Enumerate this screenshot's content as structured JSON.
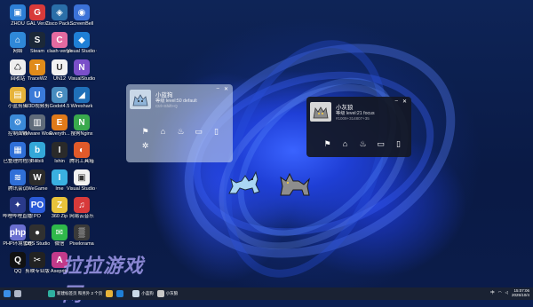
{
  "desktop_icons": [
    {
      "label": "ZHOU",
      "color": "#2d7fd6",
      "glyph": "▣",
      "name": "this-pc-icon"
    },
    {
      "label": "GAL Ver.2",
      "color": "#d83a3a",
      "glyph": "G",
      "name": "gal-icon"
    },
    {
      "label": "Cisco Pack...",
      "color": "#2a6ea8",
      "glyph": "◈",
      "name": "cisco-icon"
    },
    {
      "label": "ScreenBell",
      "color": "#3b72d8",
      "glyph": "◉",
      "name": "screenbell-icon"
    },
    {
      "label": "网络",
      "color": "#2f88d8",
      "glyph": "⌂",
      "name": "network-icon"
    },
    {
      "label": "Steam",
      "color": "#1b2838",
      "glyph": "S",
      "name": "steam-icon"
    },
    {
      "label": "clash-verge",
      "color": "#e36aa0",
      "glyph": "C",
      "name": "clash-icon"
    },
    {
      "label": "Visual Studio Code",
      "color": "#1f7fd6",
      "glyph": "◆",
      "name": "vscode-icon"
    },
    {
      "label": "回收站",
      "color": "#eeeeee",
      "glyph": "♺",
      "name": "recycle-bin-icon"
    },
    {
      "label": "TraceW2",
      "color": "#e08b1a",
      "glyph": "T",
      "name": "trace-icon"
    },
    {
      "label": "UN12",
      "color": "#f2f2f2",
      "glyph": "U",
      "name": "un12-icon"
    },
    {
      "label": "VisualStudio",
      "color": "#7a4fc9",
      "glyph": "N",
      "name": "visualstudio-icon"
    },
    {
      "label": "小蓝剪辑",
      "color": "#e6b33a",
      "glyph": "▤",
      "name": "folder-icon"
    },
    {
      "label": "U3D视频剪",
      "color": "#3a7ad8",
      "glyph": "U",
      "name": "u3d-icon"
    },
    {
      "label": "Godot4.5",
      "color": "#478cbf",
      "glyph": "G",
      "name": "godot-icon"
    },
    {
      "label": "Wireshark",
      "color": "#1f6fb8",
      "glyph": "◢",
      "name": "wireshark-icon"
    },
    {
      "label": "控制面板",
      "color": "#3b8ad8",
      "glyph": "⚙",
      "name": "control-panel-icon"
    },
    {
      "label": "VMware Workstat...",
      "color": "#5f6b7a",
      "glyph": "▥",
      "name": "vmware-icon"
    },
    {
      "label": "Everyth...",
      "color": "#e07a1a",
      "glyph": "E",
      "name": "everything-icon"
    },
    {
      "label": "搜狗Nginx",
      "color": "#39a94d",
      "glyph": "N",
      "name": "nginx-icon"
    },
    {
      "label": "已整理的程序",
      "color": "#2f6fd8",
      "glyph": "▦",
      "name": "programs-icon"
    },
    {
      "label": "Bilibili",
      "color": "#33a7d8",
      "glyph": "b",
      "name": "bilibili-icon"
    },
    {
      "label": "Ishin",
      "color": "#2a2a2a",
      "glyph": "I",
      "name": "ishin-icon"
    },
    {
      "label": "腾讯工具箱",
      "color": "#e05a2a",
      "glyph": "◐",
      "name": "toolbox-icon"
    },
    {
      "label": "腾讯会议",
      "color": "#2f6fd8",
      "glyph": "≋",
      "name": "meeting-icon"
    },
    {
      "label": "WeGame",
      "color": "#2c2c2c",
      "glyph": "W",
      "name": "wegame-icon"
    },
    {
      "label": "Ime",
      "color": "#3ab0e0",
      "glyph": "I",
      "name": "ime-icon"
    },
    {
      "label": "Visual Studio Code wor...",
      "color": "#f2f2f2",
      "glyph": "▣",
      "name": "vscode-workspace-icon"
    },
    {
      "label": "哔哩哔哩直播姬",
      "color": "#2a3a8a",
      "glyph": "✦",
      "name": "live-icon"
    },
    {
      "label": "PO",
      "color": "#2a5ad8",
      "glyph": "PO",
      "name": "po-icon"
    },
    {
      "label": "360 Zip",
      "color": "#e8c23a",
      "glyph": "Z",
      "name": "zip-icon"
    },
    {
      "label": "网易云音乐",
      "color": "#d83a3a",
      "glyph": "♫",
      "name": "netease-music-icon"
    },
    {
      "label": "PHP环境管理",
      "color": "#6a6fd0",
      "glyph": "php",
      "name": "php-icon"
    },
    {
      "label": "OBS Studio",
      "color": "#303030",
      "glyph": "●",
      "name": "obs-icon"
    },
    {
      "label": "微信",
      "color": "#2fb84a",
      "glyph": "✉",
      "name": "wechat-icon"
    },
    {
      "label": "Pixelorama",
      "color": "#3a3a3a",
      "glyph": "▒",
      "name": "pixelorama-icon"
    },
    {
      "label": "QQ",
      "color": "#111111",
      "glyph": "Q",
      "name": "qq-icon"
    },
    {
      "label": "剪映专业版",
      "color": "#222222",
      "glyph": "✂",
      "name": "capcut-icon"
    },
    {
      "label": "Aseprite",
      "color": "#c23a8a",
      "glyph": "A",
      "name": "aseprite-icon"
    }
  ],
  "panel_a": {
    "name": "小蓝狗",
    "status": "等级 level:50 default",
    "meta": "Ctrl+Shift+Q"
  },
  "panel_b": {
    "name": "小灰狼",
    "status": "等级 level:21 focus",
    "meta": "#1009+314807+35"
  },
  "actions": [
    "flag-icon",
    "home-icon",
    "feed-icon",
    "book-icon",
    "phone-icon"
  ],
  "taskbar": {
    "items": [
      {
        "name": "start-icon",
        "label": "",
        "color": "#3a8ee6"
      },
      {
        "name": "search-icon",
        "label": "",
        "color": "#b0b8c8"
      },
      {
        "name": "edge-icon",
        "label": "新建标签页 和另外 2 个页",
        "color": "#2fb0a0"
      },
      {
        "name": "files-icon",
        "label": "",
        "color": "#e6b33a"
      },
      {
        "name": "vscode-task-icon",
        "label": "",
        "color": "#1f7fd6"
      },
      {
        "name": "dog-task-icon",
        "label": "小蓝狗",
        "color": "#c9d8e8"
      },
      {
        "name": "wolf-task-icon",
        "label": "小灰狼",
        "color": "#c8c8c8"
      }
    ],
    "tray_label": "中",
    "time": "15:07:06",
    "date": "2025/10/4"
  },
  "watermark": "拉拉游戏网"
}
